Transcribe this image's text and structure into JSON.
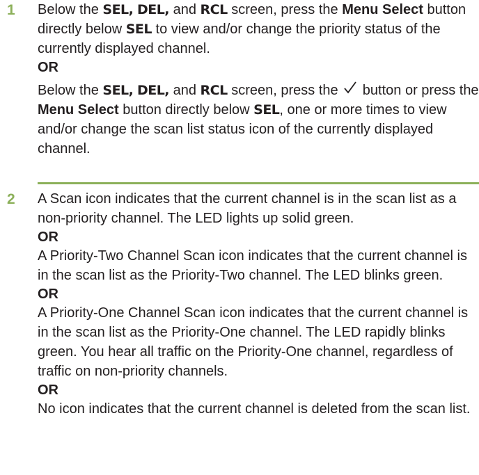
{
  "step1": {
    "number": "1",
    "p1": {
      "t1": "Below the ",
      "sel": "SEL,",
      "del": "DEL,",
      "and": " and ",
      "rcl": "RCL",
      "t2": " screen, press the ",
      "menu_select": "Menu Select",
      "t3": " button directly below ",
      "sel2": "SEL",
      "t4": " to view and/or change the priority status of the currently displayed channel."
    },
    "or": "OR",
    "p2": {
      "t1": "Below the ",
      "sel": "SEL,",
      "del": "DEL,",
      "and": " and ",
      "rcl": "RCL",
      "t2": " screen, press the ",
      "check_icon": "checkmark-icon",
      "t3": " button or press the ",
      "menu_select": "Menu Select",
      "t4": " button directly below ",
      "sel2": "SEL",
      "t5": ", one or more times to view and/or change the scan list status icon of the currently displayed channel."
    }
  },
  "step2": {
    "number": "2",
    "para1": "A Scan icon indicates that the current channel is in the scan list as a non-priority channel. The LED lights up solid green.",
    "or1": "OR",
    "para2": "A Priority-Two Channel Scan icon indicates that the current channel is in the scan list as the Priority-Two channel. The LED blinks green.",
    "or2": "OR",
    "para3": "A Priority-One Channel Scan icon indicates that the current channel is in the scan list as the Priority-One channel. The LED rapidly blinks green. You hear all traffic on the Priority-One channel, regardless of traffic on non-priority channels.",
    "or3": "OR",
    "para4": "No icon indicates that the current channel is deleted from the scan list."
  },
  "colors": {
    "accent": "#8cb05a",
    "text": "#231f20"
  }
}
